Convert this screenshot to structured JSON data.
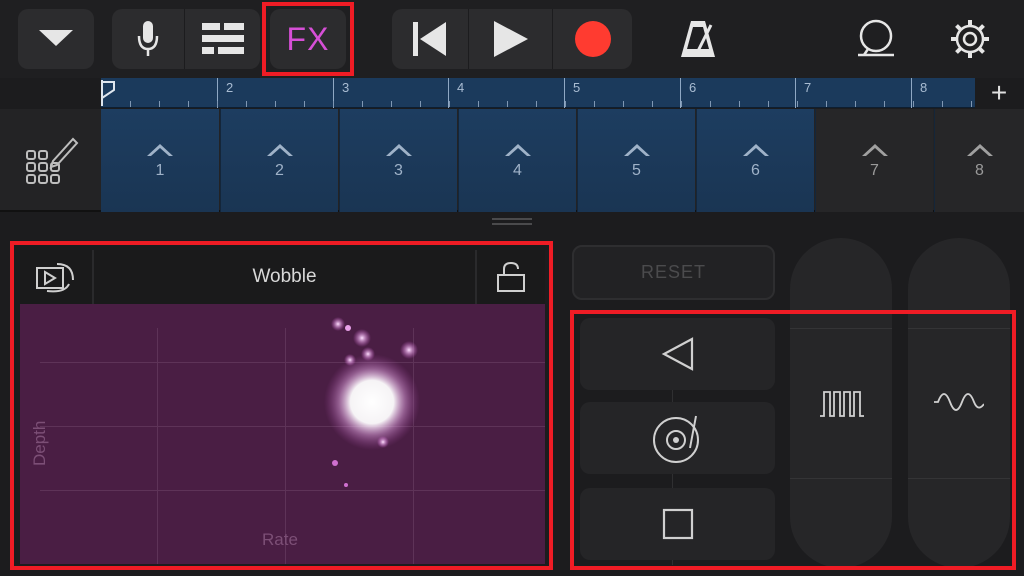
{
  "toolbar": {
    "fx_label": "FX"
  },
  "ruler": {
    "bars": [
      "2",
      "3",
      "4",
      "5",
      "6",
      "7",
      "8"
    ],
    "add_label": "+"
  },
  "chords": [
    "1",
    "2",
    "3",
    "4",
    "5",
    "6",
    "7",
    "8"
  ],
  "fx_pad": {
    "title": "Wobble",
    "x_label": "Rate",
    "y_label": "Depth"
  },
  "controls": {
    "reset_label": "RESET"
  },
  "colors": {
    "fx_accent": "#d64fd6",
    "record": "#ff3b30",
    "highlight_box": "#ef1c25",
    "pad_bg": "#4a1e44"
  },
  "icons": [
    "chevron-down-icon",
    "microphone-icon",
    "tracks-view-icon",
    "rewind-icon",
    "play-icon",
    "record-icon",
    "metronome-icon",
    "loop-browser-icon",
    "settings-gear-icon",
    "chord-edit-icon",
    "lock-icon",
    "retrigger-icon",
    "reverse-icon",
    "turntable-icon",
    "stop-icon",
    "square-wave-icon",
    "sine-wave-icon"
  ]
}
